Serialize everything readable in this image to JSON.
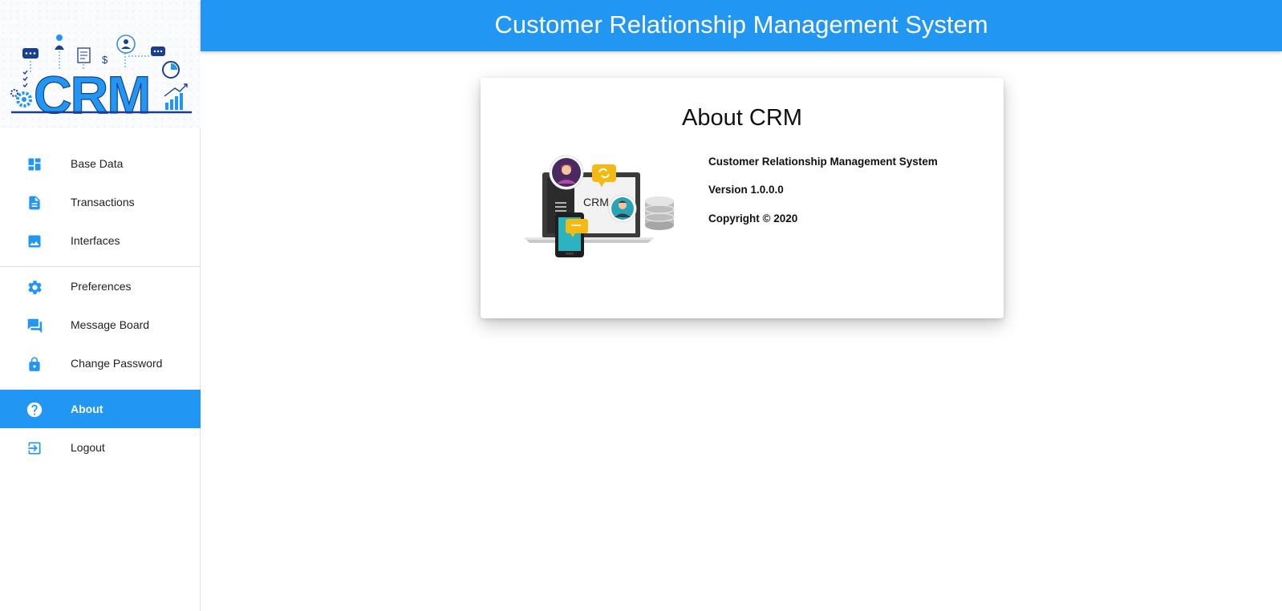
{
  "header": {
    "title": "Customer Relationship Management System"
  },
  "logo": {
    "text": "CRM"
  },
  "nav": {
    "items": [
      {
        "label": "Base Data",
        "icon": "dashboard-icon"
      },
      {
        "label": "Transactions",
        "icon": "document-icon"
      },
      {
        "label": "Interfaces",
        "icon": "image-icon"
      },
      {
        "label": "Preferences",
        "icon": "gear-icon"
      },
      {
        "label": "Message Board",
        "icon": "forum-icon"
      },
      {
        "label": "Change Password",
        "icon": "lock-icon"
      },
      {
        "label": "About",
        "icon": "help-circle-icon",
        "active": true
      },
      {
        "label": "Logout",
        "icon": "logout-icon"
      }
    ]
  },
  "about": {
    "title": "About CRM",
    "illustration_text": "CRM",
    "product_name": "Customer Relationship Management System",
    "version": "Version 1.0.0.0",
    "copyright": "Copyright © 2020"
  },
  "colors": {
    "accent": "#2196f3",
    "active_text": "#ffffff"
  }
}
